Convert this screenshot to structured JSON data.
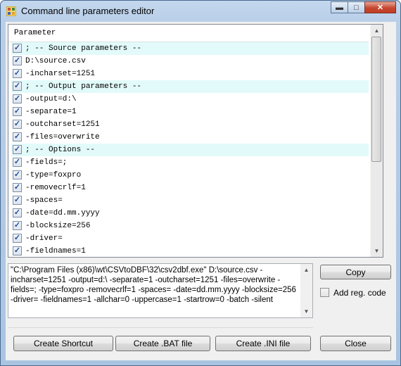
{
  "window": {
    "title": "Command line parameters editor"
  },
  "grid": {
    "header": "Parameter",
    "rows": [
      {
        "text": "; -- Source parameters --",
        "checked": true,
        "highlight": true
      },
      {
        "text": "D:\\source.csv",
        "checked": true,
        "highlight": false
      },
      {
        "text": "-incharset=1251",
        "checked": true,
        "highlight": false
      },
      {
        "text": "; -- Output parameters --",
        "checked": true,
        "highlight": true
      },
      {
        "text": "-output=d:\\",
        "checked": true,
        "highlight": false
      },
      {
        "text": "-separate=1",
        "checked": true,
        "highlight": false
      },
      {
        "text": "-outcharset=1251",
        "checked": true,
        "highlight": false
      },
      {
        "text": "-files=overwrite",
        "checked": true,
        "highlight": false
      },
      {
        "text": "; -- Options --",
        "checked": true,
        "highlight": true
      },
      {
        "text": "-fields=;",
        "checked": true,
        "highlight": false
      },
      {
        "text": "-type=foxpro",
        "checked": true,
        "highlight": false
      },
      {
        "text": "-removecrlf=1",
        "checked": true,
        "highlight": false
      },
      {
        "text": "-spaces=",
        "checked": true,
        "highlight": false
      },
      {
        "text": "-date=dd.mm.yyyy",
        "checked": true,
        "highlight": false
      },
      {
        "text": "-blocksize=256",
        "checked": true,
        "highlight": false
      },
      {
        "text": "-driver=",
        "checked": true,
        "highlight": false
      },
      {
        "text": "-fieldnames=1",
        "checked": true,
        "highlight": false
      }
    ]
  },
  "command_text": "\"C:\\Program Files (x86)\\wt\\CSVtoDBF\\32\\csv2dbf.exe\" D:\\source.csv -incharset=1251 -output=d:\\ -separate=1 -outcharset=1251 -files=overwrite -fields=; -type=foxpro -removecrlf=1 -spaces= -date=dd.mm.yyyy -blocksize=256 -driver= -fieldnames=1 -allchar=0 -uppercase=1 -startrow=0 -batch -silent",
  "buttons": {
    "copy": "Copy",
    "create_shortcut": "Create Shortcut",
    "create_bat": "Create .BAT file",
    "create_ini": "Create .INI file",
    "close": "Close"
  },
  "add_reg_code": {
    "label": "Add reg. code",
    "checked": false
  }
}
